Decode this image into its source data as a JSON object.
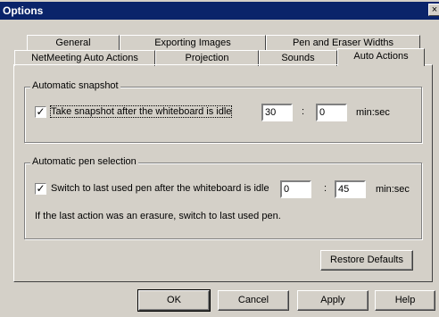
{
  "window": {
    "title": "Options",
    "close_glyph": "×"
  },
  "tabs_row1": [
    {
      "label": "General"
    },
    {
      "label": "Exporting Images"
    },
    {
      "label": "Pen and Eraser Widths"
    }
  ],
  "tabs_row2": [
    {
      "label": "NetMeeting Auto Actions"
    },
    {
      "label": "Projection"
    },
    {
      "label": "Sounds"
    },
    {
      "label": "Auto Actions",
      "active": true
    }
  ],
  "snapshot": {
    "group_title": "Automatic snapshot",
    "checkbox_checked": true,
    "checkbox_label": "Take snapshot after the whiteboard is idle",
    "minutes": "30",
    "separator": ":",
    "seconds": "0",
    "unit_label": "min:sec"
  },
  "pen": {
    "group_title": "Automatic pen selection",
    "checkbox_checked": true,
    "checkbox_label": "Switch to last used pen after the whiteboard is idle",
    "minutes": "0",
    "separator": ":",
    "seconds": "45",
    "unit_label": "min:sec",
    "note": "If the last action was an erasure, switch to last used pen."
  },
  "buttons": {
    "restore_defaults": "Restore Defaults",
    "ok": "OK",
    "cancel": "Cancel",
    "apply": "Apply",
    "help": "Help"
  },
  "check_glyph": "✓"
}
